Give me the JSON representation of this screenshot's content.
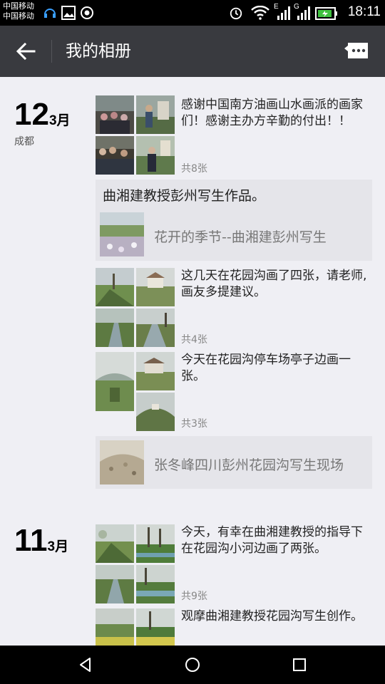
{
  "status_bar": {
    "carrier_1": "中国移动",
    "carrier_2": "中国移动",
    "net_1": "E",
    "net_2": "G",
    "time": "18:11"
  },
  "header": {
    "title": "我的相册",
    "back_icon": "back-arrow-icon",
    "message_icon": "message-icon"
  },
  "days": [
    {
      "day": "12",
      "month": "3月",
      "location": "成都",
      "posts": [
        {
          "text": "感谢中国南方油画山水画派的画家们！感谢主办方辛勤的付出！！",
          "count": "共8张"
        }
      ],
      "share_1": {
        "title": "曲湘建教授彭州写生作品。",
        "text": "花开的季节--曲湘建彭州写生"
      },
      "posts_2": [
        {
          "text": "这几天在花园沟画了四张，请老师,画友多提建议。",
          "count": "共4张"
        },
        {
          "text": "今天在花园沟停车场亭子边画一张。",
          "count": "共3张"
        }
      ],
      "share_2": {
        "text": "张冬峰四川彭州花园沟写生现场"
      }
    },
    {
      "day": "11",
      "month": "3月",
      "posts": [
        {
          "text": "今天，有幸在曲湘建教授的指导下在花园沟小河边画了两张。",
          "count": "共9张"
        },
        {
          "text": "观摩曲湘建教授花园沟写生创作。"
        }
      ]
    }
  ]
}
